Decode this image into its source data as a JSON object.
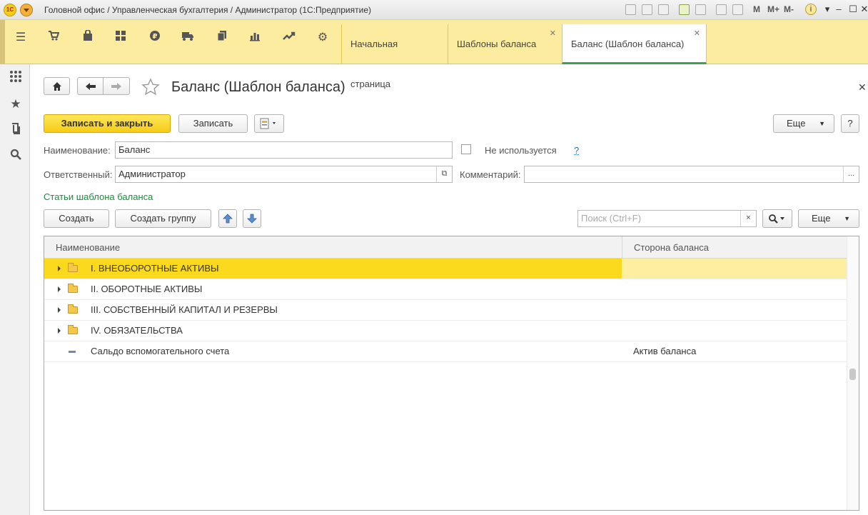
{
  "window": {
    "title": "Головной офис / Управленческая бухгалтерия / Администратор  (1С:Предприятие)",
    "logo_text": "1С",
    "memory_buttons": [
      "M",
      "M+",
      "M-"
    ]
  },
  "sections": {
    "icons": [
      "menu-icon",
      "cart-icon",
      "bag-icon",
      "grid-icon",
      "ruble-icon",
      "truck-icon",
      "documents-icon",
      "bar-chart-icon",
      "trend-icon",
      "gear-icon"
    ],
    "tabs": [
      {
        "label": "Начальная страница"
      },
      {
        "label": "Шаблоны баланса"
      },
      {
        "label": "Баланс (Шаблон баланса)"
      }
    ]
  },
  "form": {
    "title": "Баланс (Шаблон баланса)",
    "buttons": {
      "save_close": "Записать и закрыть",
      "save": "Записать",
      "more": "Еще",
      "help": "?"
    },
    "name_label": "Наименование:",
    "name_value": "Баланс",
    "not_used_label": "Не используется",
    "help_link": "?",
    "responsible_label": "Ответственный:",
    "responsible_value": "Администратор",
    "comment_label": "Комментарий:",
    "comment_value": "",
    "items_section_label": "Статьи шаблона баланса"
  },
  "table_toolbar": {
    "create": "Создать",
    "create_group": "Создать группу",
    "search_placeholder": "Поиск (Ctrl+F)",
    "more": "Еще"
  },
  "table": {
    "columns": [
      "Наименование",
      "Сторона баланса"
    ],
    "rows": [
      {
        "name": "I. ВНЕОБОРОТНЫЕ АКТИВЫ",
        "side": "",
        "type": "group",
        "selected": true
      },
      {
        "name": "II. ОБОРОТНЫЕ АКТИВЫ",
        "side": "",
        "type": "group",
        "selected": false
      },
      {
        "name": "III. СОБСТВЕННЫЙ КАПИТАЛ И РЕЗЕРВЫ",
        "side": "",
        "type": "group",
        "selected": false
      },
      {
        "name": "IV. ОБЯЗАТЕЛЬСТВА",
        "side": "",
        "type": "group",
        "selected": false
      },
      {
        "name": "Сальдо вспомогательного счета",
        "side": "Актив баланса",
        "type": "item",
        "selected": false
      }
    ]
  }
}
